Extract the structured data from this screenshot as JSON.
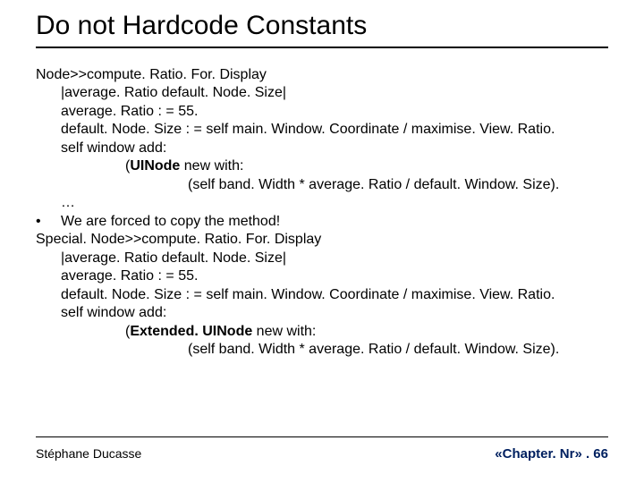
{
  "title": "Do not Hardcode Constants",
  "code1": {
    "l1": "Node>>compute. Ratio. For. Display",
    "l2": "|average. Ratio default. Node. Size|",
    "l3": "average. Ratio : = 55.",
    "l4": "default. Node. Size : = self main. Window. Coordinate / maximise. View. Ratio.",
    "l5": "self window add:",
    "l6_pre": "(",
    "l6_bold": "UINode",
    "l6_post": " new with:",
    "l7": "(self band. Width * average. Ratio / default. Window. Size).",
    "l8": "…"
  },
  "bullet": {
    "mark": "•",
    "text": "We are forced to copy the method!"
  },
  "code2": {
    "l1": "Special. Node>>compute. Ratio. For. Display",
    "l2": "|average. Ratio default. Node. Size|",
    "l3": "average. Ratio : = 55.",
    "l4": "default. Node. Size : = self main. Window. Coordinate / maximise. View. Ratio.",
    "l5": "self window add:",
    "l6_pre": "(",
    "l6_bold": "Extended. UINode",
    "l6_post": " new with:",
    "l7": "(self band. Width * average. Ratio / default. Window. Size)."
  },
  "footer": {
    "author": "Stéphane Ducasse",
    "pager": "«Chapter. Nr» . 66"
  }
}
